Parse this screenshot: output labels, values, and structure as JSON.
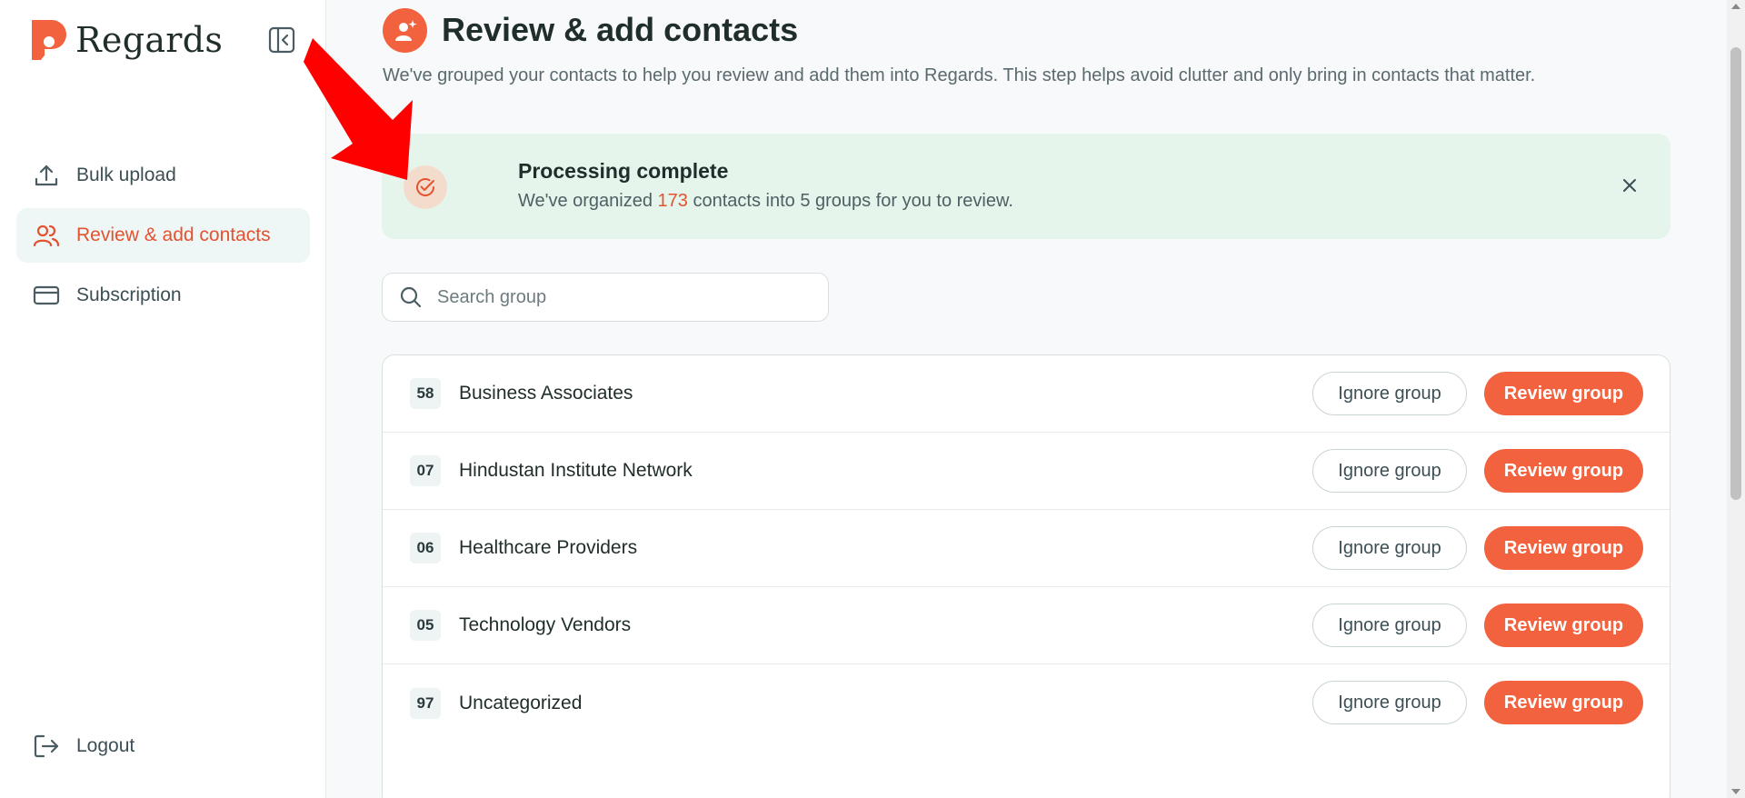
{
  "brand": {
    "name": "Regards"
  },
  "sidebar": {
    "items": [
      {
        "label": "Bulk upload",
        "icon": "upload-icon",
        "active": false
      },
      {
        "label": "Review & add contacts",
        "icon": "users-icon",
        "active": true
      },
      {
        "label": "Subscription",
        "icon": "credit-card-icon",
        "active": false
      }
    ],
    "logout_label": "Logout"
  },
  "header": {
    "title": "Review & add contacts",
    "subtitle": "We've grouped your contacts to help you review and add them into Regards. This step helps avoid clutter and only bring in contacts that matter."
  },
  "alert": {
    "title": "Processing complete",
    "text_before": "We've organized ",
    "count": "173",
    "text_after": " contacts into 5 groups for you to review."
  },
  "search": {
    "placeholder": "Search group"
  },
  "groups": [
    {
      "count": "58",
      "name": "Business Associates"
    },
    {
      "count": "07",
      "name": "Hindustan Institute Network"
    },
    {
      "count": "06",
      "name": "Healthcare Providers"
    },
    {
      "count": "05",
      "name": "Technology Vendors"
    },
    {
      "count": "97",
      "name": "Uncategorized"
    }
  ],
  "buttons": {
    "ignore_label": "Ignore group",
    "review_label": "Review group"
  },
  "colors": {
    "accent": "#f2623f",
    "active_text": "#e5522f",
    "alert_bg": "#e5f5ec",
    "annotation_arrow": "#ff0000"
  }
}
